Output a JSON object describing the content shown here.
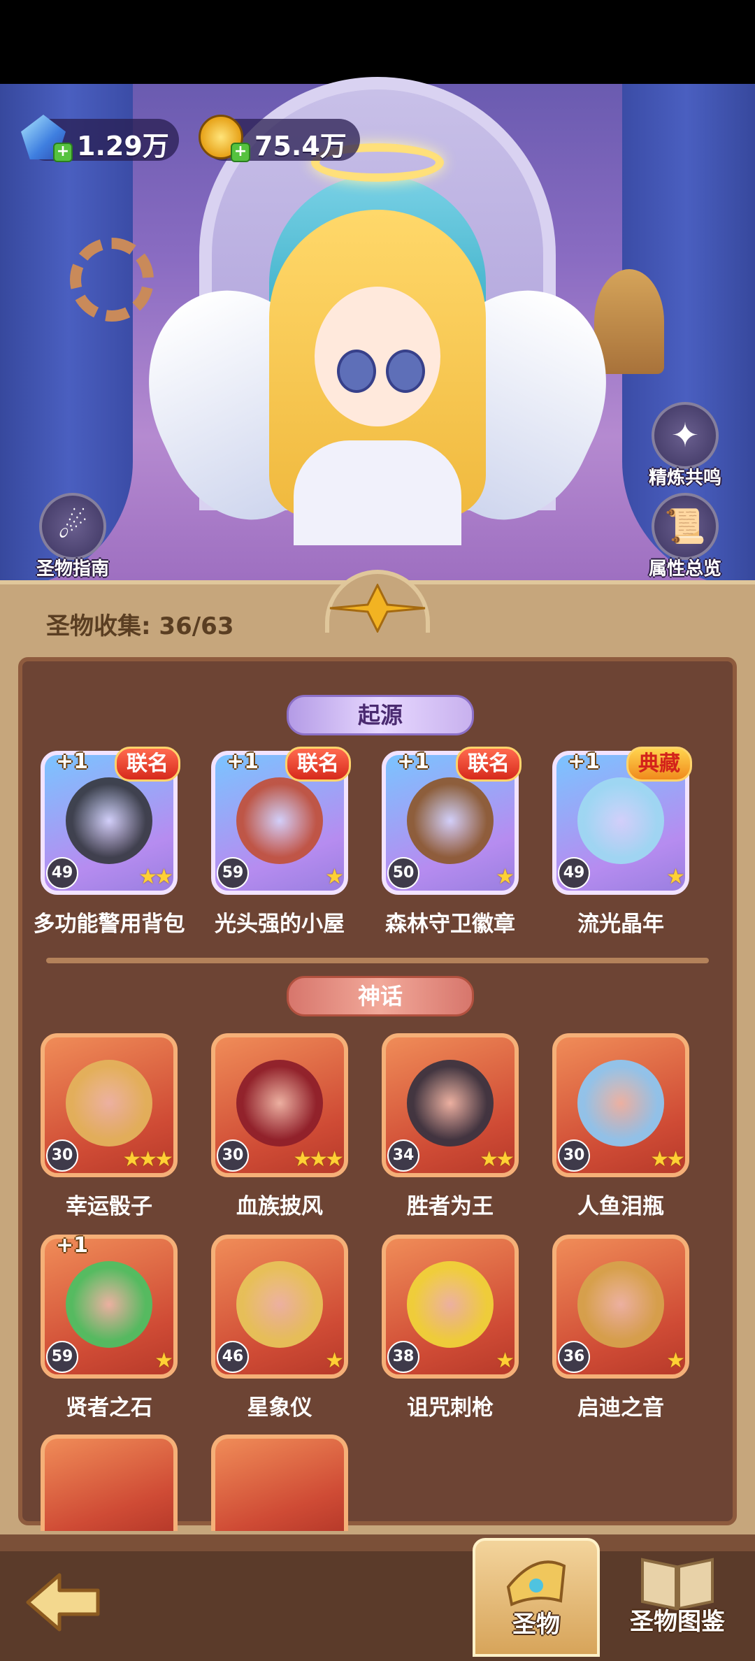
{
  "resources": {
    "diamonds": "1.29万",
    "gold": "75.4万"
  },
  "side_buttons": {
    "guide": "圣物指南",
    "refine": "精炼共鸣",
    "attributes": "属性总览"
  },
  "collection": {
    "label": "圣物收集: 36/63"
  },
  "sections": {
    "origin": "起源",
    "myth": "神话"
  },
  "origin_items": [
    {
      "name": "多功能警用背包",
      "level": "49",
      "stars": "★★",
      "plus": "+1",
      "tag": "联名",
      "art": "#3a3c46"
    },
    {
      "name": "光头强的小屋",
      "level": "59",
      "stars": "★",
      "plus": "+1",
      "tag": "联名",
      "art": "#c0523e"
    },
    {
      "name": "森林守卫徽章",
      "level": "50",
      "stars": "★",
      "plus": "+1",
      "tag": "联名",
      "art": "#8d5a32"
    },
    {
      "name": "流光晶年",
      "level": "49",
      "stars": "★",
      "plus": "+1",
      "tag": "典藏",
      "art": "#9fd8f2"
    }
  ],
  "myth_items_row1": [
    {
      "name": "幸运骰子",
      "level": "30",
      "stars": "★★★",
      "art": "#e3b25c"
    },
    {
      "name": "血族披风",
      "level": "30",
      "stars": "★★★",
      "art": "#8e1f2a"
    },
    {
      "name": "胜者为王",
      "level": "34",
      "stars": "★★",
      "art": "#3b3340"
    },
    {
      "name": "人鱼泪瓶",
      "level": "30",
      "stars": "★★",
      "art": "#8fc6f0"
    }
  ],
  "myth_items_row2": [
    {
      "name": "贤者之石",
      "level": "59",
      "stars": "★",
      "plus": "+1",
      "art": "#4fbf62"
    },
    {
      "name": "星象仪",
      "level": "46",
      "stars": "★",
      "art": "#e7c35a"
    },
    {
      "name": "诅咒刺枪",
      "level": "38",
      "stars": "★",
      "art": "#f0d23a"
    },
    {
      "name": "启迪之音",
      "level": "36",
      "stars": "★",
      "art": "#d6a24c"
    }
  ],
  "bottom_tabs": {
    "relics": "圣物",
    "codex": "圣物图鉴"
  },
  "colors": {
    "panel_bg": "#6d4434",
    "origin_card": "#7ac4ff",
    "myth_card": "#cf4b35"
  }
}
